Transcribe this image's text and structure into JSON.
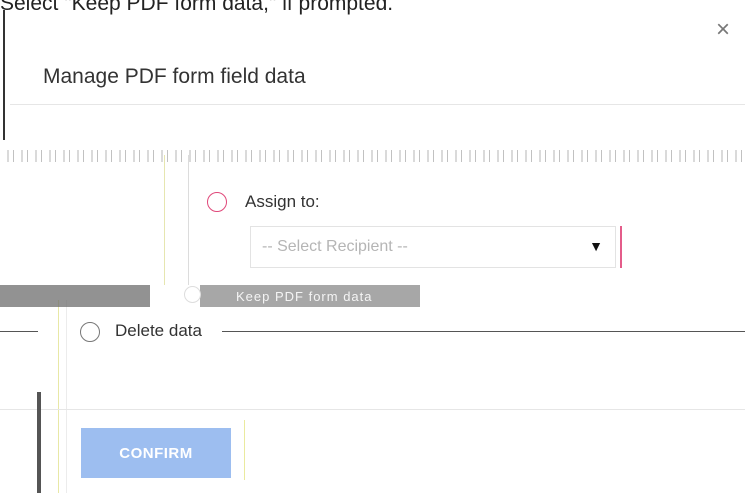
{
  "caption": "Select \"Keep PDF form data,\" if prompted.",
  "dialog": {
    "title": "Manage PDF form field data",
    "close_glyph": "×",
    "options": {
      "assign_label": "Assign to:",
      "select_placeholder": "-- Select Recipient --",
      "select_arrow": "▼",
      "keep_label": "Keep PDF form data",
      "delete_label": "Delete data"
    },
    "confirm_label": "CONFIRM"
  },
  "colors": {
    "accent_pink": "#e0487a",
    "confirm_bg": "#9dbef0"
  }
}
